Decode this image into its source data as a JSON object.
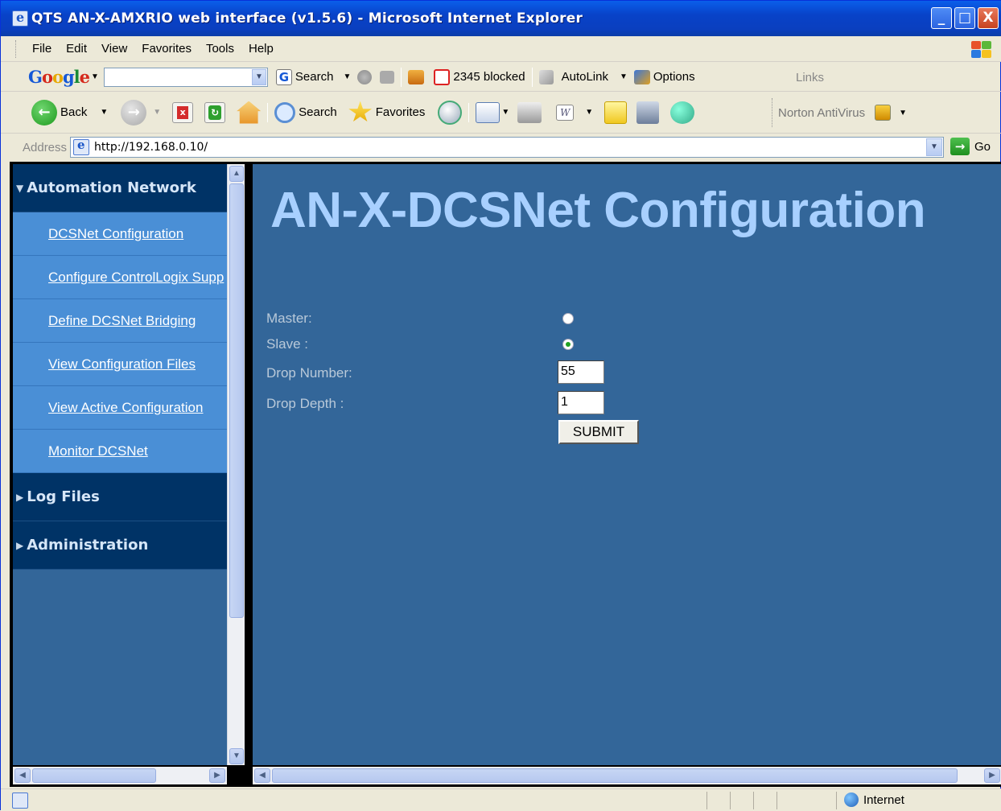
{
  "window": {
    "title": "QTS AN-X-AMXRIO web interface (v1.5.6) - Microsoft Internet Explorer",
    "controls": {
      "minimize": "_",
      "maximize": "□",
      "close": "X"
    }
  },
  "menubar": {
    "items": [
      "File",
      "Edit",
      "View",
      "Favorites",
      "Tools",
      "Help"
    ]
  },
  "google_toolbar": {
    "logo": {
      "G": "G",
      "o1": "o",
      "o2": "o",
      "g": "g",
      "l": "l",
      "e": "e"
    },
    "search_label": "Search",
    "blocked_label": "2345 blocked",
    "autolink_label": "AutoLink",
    "options_label": "Options",
    "links_label": "Links"
  },
  "std_toolbar": {
    "back_label": "Back",
    "search_label": "Search",
    "favorites_label": "Favorites",
    "norton_label": "Norton AntiVirus"
  },
  "address_bar": {
    "label": "Address",
    "url": "http://192.168.0.10/",
    "go_label": "Go"
  },
  "sidebar": {
    "sections": [
      {
        "label": "Automation Network",
        "expanded": true,
        "links": [
          "DCSNet Configuration",
          "Configure ControlLogix Supp",
          "Define DCSNet Bridging",
          "View Configuration Files",
          "View Active Configuration",
          "Monitor DCSNet"
        ]
      },
      {
        "label": "Log Files",
        "expanded": false
      },
      {
        "label": "Administration",
        "expanded": false
      }
    ]
  },
  "main": {
    "heading": "AN-X-DCSNet Configuration",
    "form": {
      "master_label": "Master:",
      "slave_label": "Slave :",
      "mode_selected": "slave",
      "drop_number_label": "Drop Number:",
      "drop_number_value": "55",
      "drop_depth_label": "Drop Depth :",
      "drop_depth_value": "1",
      "submit_label": "SUBMIT"
    }
  },
  "status_bar": {
    "zone_label": "Internet"
  },
  "colors": {
    "nav_header_bg": "#003366",
    "nav_link_bg": "#4a8fd6",
    "main_bg": "#336699",
    "heading_color": "#a8d0ff",
    "title_bar": "#0842c8"
  }
}
